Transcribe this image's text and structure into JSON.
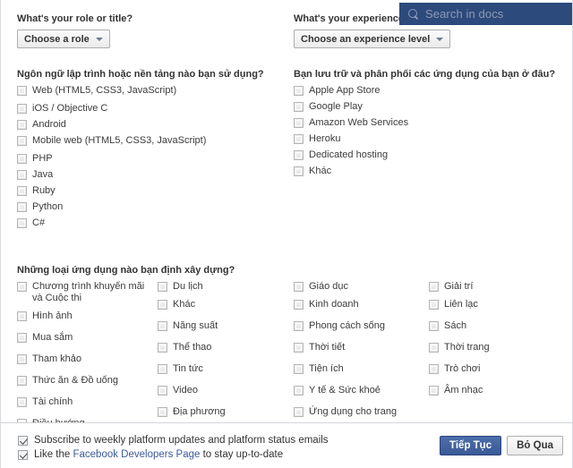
{
  "search": {
    "placeholder": "Search in docs",
    "icon": "search-icon",
    "bg_color": "#2c4a7c"
  },
  "left": {
    "role_question": "What's your role or title?",
    "role_dropdown": "Choose a role",
    "languages_question": "Ngôn ngữ lập trình hoặc nền tảng nào bạn sử dụng?",
    "languages": [
      "Web (HTML5, CSS3, JavaScript)",
      "iOS / Objective C",
      "Android",
      "Mobile web (HTML5, CSS3, JavaScript)",
      "PHP",
      "Java",
      "Ruby",
      "Python",
      "C#"
    ]
  },
  "right": {
    "experience_question": "What's your experience l",
    "experience_dropdown": "Choose an experience level",
    "hosting_question": "Bạn lưu trữ và phân phối các ứng dụng của bạn ở đâu?",
    "hosting": [
      "Apple App Store",
      "Google Play",
      "Amazon Web Services",
      "Heroku",
      "Dedicated hosting",
      "Khác"
    ]
  },
  "apps": {
    "question": "Những loại ứng dụng nào bạn định xây dựng?",
    "columns": [
      [
        "Chương trình khuyến mãi và Cuộc thi",
        "Hình ảnh",
        "Mua sắm",
        "Tham khảo",
        "Thức ăn & Đồ uống",
        "Tài chính",
        "Điều hướng"
      ],
      [
        "Du lịch",
        "Khác",
        "Năng suất",
        "Thể thao",
        "Tin tức",
        "Video",
        "Địa phương"
      ],
      [
        "Giáo dục",
        "Kinh doanh",
        "Phong cách sống",
        "Thời tiết",
        "Tiện ích",
        "Y tế & Sức khoẻ",
        "Ứng dụng cho trang"
      ],
      [
        "Giải trí",
        "Liên lạc",
        "Sách",
        "Thời trang",
        "Trò chơi",
        "Âm nhạc"
      ]
    ]
  },
  "footer": {
    "subscribe_label": "Subscribe to weekly platform updates and platform status emails",
    "subscribe_checked": true,
    "like_prefix": "Like the ",
    "like_link": "Facebook Developers Page",
    "like_suffix": " to stay up-to-date",
    "like_checked": true,
    "continue_label": "Tiếp Tục",
    "skip_label": "Bỏ Qua",
    "primary_color": "#3b5998"
  }
}
